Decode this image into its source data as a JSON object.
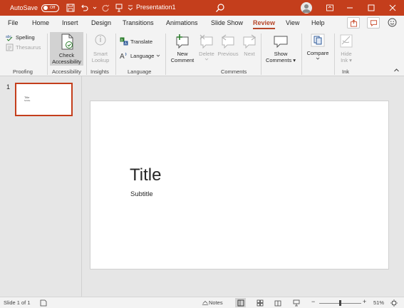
{
  "titlebar": {
    "autosave_label": "AutoSave",
    "autosave_state": "Off",
    "doc_title": "Presentation1"
  },
  "tabs": [
    "File",
    "Home",
    "Insert",
    "Design",
    "Transitions",
    "Animations",
    "Slide Show",
    "Review",
    "View",
    "Help"
  ],
  "active_tab": "Review",
  "ribbon": {
    "proofing": {
      "spelling": "Spelling",
      "thesaurus": "Thesaurus",
      "label": "Proofing"
    },
    "accessibility": {
      "check_line1": "Check",
      "check_line2": "Accessibility",
      "label": "Accessibility"
    },
    "insights": {
      "smart_line1": "Smart",
      "smart_line2": "Lookup",
      "label": "Insights"
    },
    "language": {
      "translate": "Translate",
      "language": "Language",
      "label": "Language"
    },
    "comments": {
      "new_line1": "New",
      "new_line2": "Comment",
      "delete": "Delete",
      "previous": "Previous",
      "next": "Next",
      "show_line1": "Show",
      "show_line2": "Comments",
      "label": "Comments"
    },
    "compare": {
      "compare": "Compare"
    },
    "ink": {
      "hide_line1": "Hide",
      "hide_line2": "Ink",
      "label": "Ink"
    }
  },
  "thumbnails": [
    {
      "number": "1",
      "title": "Title",
      "subtitle": "Subtitle"
    }
  ],
  "slide": {
    "title": "Title",
    "subtitle": "Subtitle"
  },
  "statusbar": {
    "slide_info": "Slide 1 of 1",
    "notes": "Notes",
    "zoom_minus": "−",
    "zoom_plus": "+",
    "zoom_level": "51%",
    "zoom_fraction": 0.51
  },
  "colors": {
    "accent": "#c43e1c",
    "active_tab": "#b7472a",
    "ribbon_bg": "#f3f3f3",
    "canvas_bg": "#e6e6e6"
  }
}
